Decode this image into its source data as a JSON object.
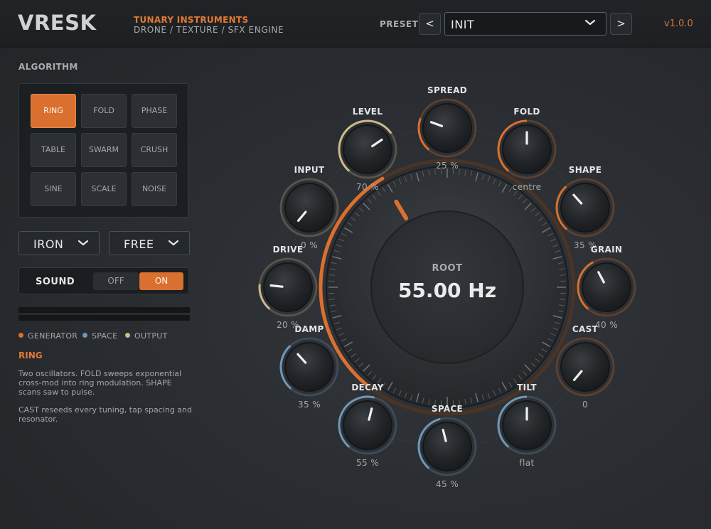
{
  "header": {
    "logo": "VRESK",
    "brand": "TUNARY INSTRUMENTS",
    "subtitle": "DRONE / TEXTURE / SFX ENGINE",
    "preset_label": "PRESET",
    "preset_prev": "<",
    "preset_next": ">",
    "preset_name": "INIT",
    "version": "v1.0.0"
  },
  "algorithm": {
    "label": "ALGORITHM",
    "selected": "RING",
    "buttons": [
      "RING",
      "FOLD",
      "PHASE",
      "TABLE",
      "SWARM",
      "CRUSH",
      "SINE",
      "SCALE",
      "NOISE"
    ]
  },
  "mode_dropdown": "IRON",
  "sync_dropdown": "FREE",
  "sound": {
    "label": "SOUND",
    "off": "OFF",
    "on": "ON",
    "state": "ON"
  },
  "legend": {
    "generator": "GENERATOR",
    "space": "SPACE",
    "output": "OUTPUT"
  },
  "colors": {
    "generator": "#d9702f",
    "space": "#6f97b8",
    "output": "#cdb98a",
    "accent": "#d9702f"
  },
  "description": {
    "title": "RING",
    "p1": "Two oscillators. FOLD sweeps exponential cross-mod into ring modulation. SHAPE scans saw to pulse.",
    "p2": "CAST reseeds every tuning, tap spacing and resonator."
  },
  "root": {
    "label": "ROOT",
    "value": "55.00 Hz",
    "level": 0.39
  },
  "knobs": [
    {
      "id": "spread",
      "label": "SPREAD",
      "value": "25 %",
      "level": 0.25,
      "group": "generator"
    },
    {
      "id": "fold",
      "label": "FOLD",
      "value": "centre",
      "level": 0.5,
      "group": "generator"
    },
    {
      "id": "shape",
      "label": "SHAPE",
      "value": "35 %",
      "level": 0.35,
      "group": "generator"
    },
    {
      "id": "grain",
      "label": "GRAIN",
      "value": "40 %",
      "level": 0.4,
      "group": "generator"
    },
    {
      "id": "cast",
      "label": "CAST",
      "value": "0",
      "level": 0.0,
      "group": "generator"
    },
    {
      "id": "tilt",
      "label": "TILT",
      "value": "flat",
      "level": 0.5,
      "group": "space"
    },
    {
      "id": "space",
      "label": "SPACE",
      "value": "45 %",
      "level": 0.45,
      "group": "space"
    },
    {
      "id": "decay",
      "label": "DECAY",
      "value": "55 %",
      "level": 0.55,
      "group": "space"
    },
    {
      "id": "damp",
      "label": "DAMP",
      "value": "35 %",
      "level": 0.35,
      "group": "space"
    },
    {
      "id": "drive",
      "label": "DRIVE",
      "value": "20 %",
      "level": 0.2,
      "group": "output"
    },
    {
      "id": "input",
      "label": "INPUT",
      "value": "0 %",
      "level": 0.0,
      "group": "output"
    },
    {
      "id": "level",
      "label": "LEVEL",
      "value": "70 %",
      "level": 0.7,
      "group": "output"
    }
  ]
}
